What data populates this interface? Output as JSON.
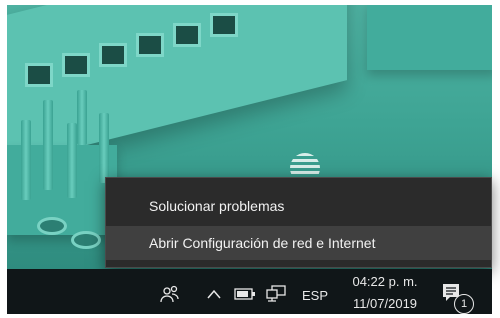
{
  "context_menu": {
    "items": [
      {
        "label": "Solucionar problemas",
        "hovered": false
      },
      {
        "label": "Abrir Configuración de red e Internet",
        "hovered": true
      }
    ]
  },
  "taskbar": {
    "language": "ESP",
    "time": "04:22 p. m.",
    "date": "11/07/2019",
    "notification_count": "1",
    "icons": [
      "people-icon",
      "chevron-up-icon",
      "battery-icon",
      "network-icon",
      "action-center-icon"
    ]
  },
  "colors": {
    "menu_bg": "#2b2b2b",
    "menu_hover": "#404040",
    "taskbar_bg": "#101618",
    "wallpaper": "#3ea494"
  }
}
